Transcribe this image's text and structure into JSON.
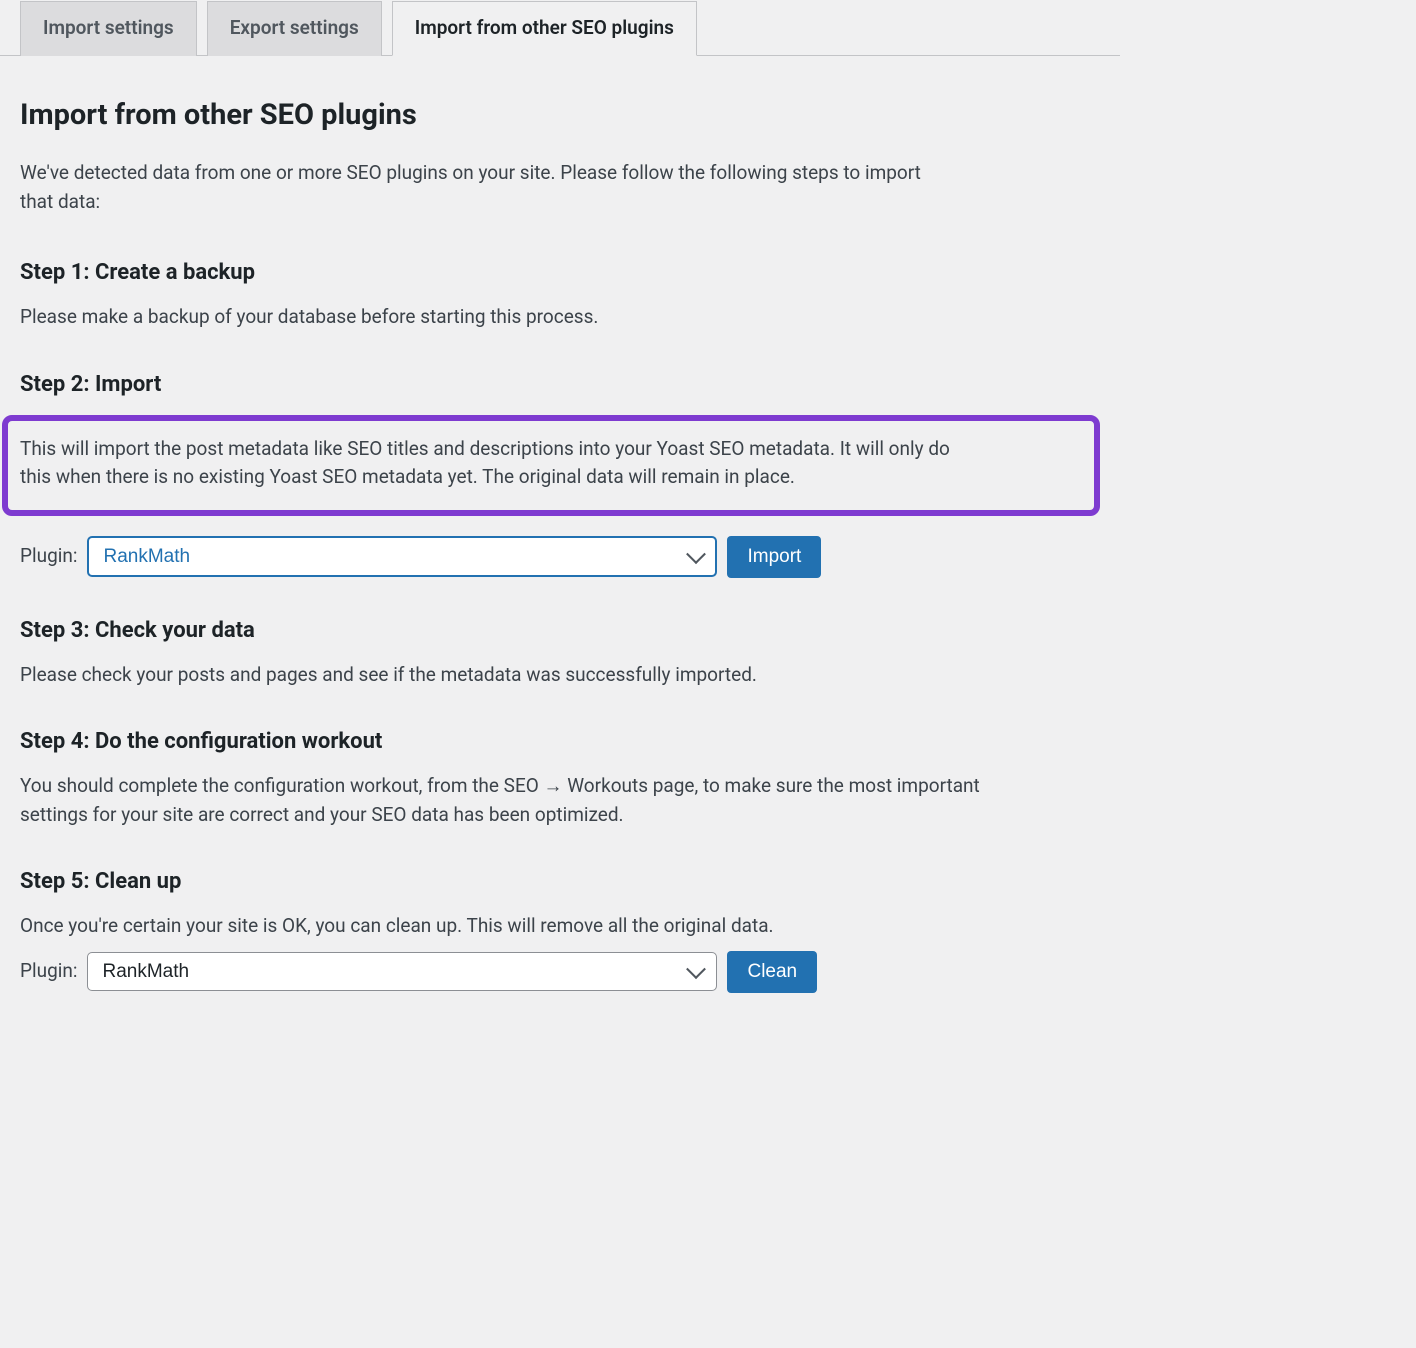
{
  "tabs": {
    "import_settings": "Import settings",
    "export_settings": "Export settings",
    "import_other": "Import from other SEO plugins"
  },
  "page": {
    "heading": "Import from other SEO plugins",
    "intro": "We've detected data from one or more SEO plugins on your site. Please follow the following steps to import that data:"
  },
  "step1": {
    "heading": "Step 1: Create a backup",
    "desc": "Please make a backup of your database before starting this process."
  },
  "step2": {
    "heading": "Step 2: Import",
    "desc": "This will import the post metadata like SEO titles and descriptions into your Yoast SEO metadata. It will only do this when there is no existing Yoast SEO metadata yet. The original data will remain in place.",
    "plugin_label": "Plugin:",
    "plugin_selected": "RankMath",
    "import_button": "Import"
  },
  "step3": {
    "heading": "Step 3: Check your data",
    "desc": "Please check your posts and pages and see if the metadata was successfully imported."
  },
  "step4": {
    "heading": "Step 4: Do the configuration workout",
    "desc": "You should complete the configuration workout, from the SEO → Workouts page, to make sure the most important settings for your site are correct and your SEO data has been optimized."
  },
  "step5": {
    "heading": "Step 5: Clean up",
    "desc": "Once you're certain your site is OK, you can clean up. This will remove all the original data.",
    "plugin_label": "Plugin:",
    "plugin_selected": "RankMath",
    "clean_button": "Clean"
  }
}
